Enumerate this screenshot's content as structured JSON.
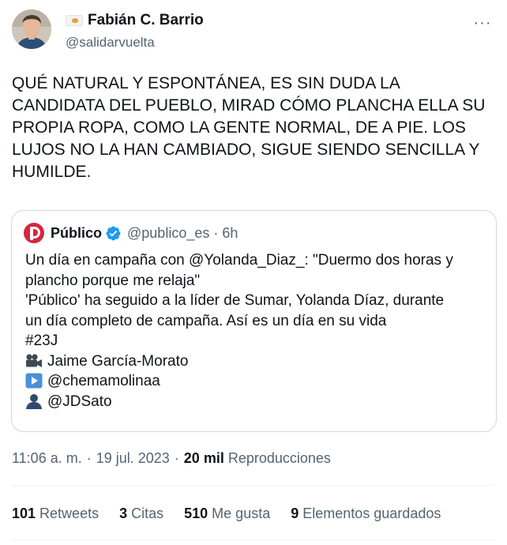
{
  "author": {
    "display_name": "Fabián C. Barrio",
    "handle": "@salidarvuelta",
    "more_label": "···"
  },
  "tweet_text": "QUÉ NATURAL Y ESPONTÁNEA, ES SIN DUDA LA CANDIDATA DEL PUEBLO, MIRAD CÓMO PLANCHA ELLA SU PROPIA ROPA, COMO LA GENTE NORMAL, DE A PIE. LOS LUJOS NO LA HAN CAMBIADO, SIGUE SIENDO SENCILLA Y HUMILDE.",
  "quoted": {
    "name": "Público",
    "handle": "@publico_es",
    "separator": "·",
    "time": "6h",
    "lines": [
      "Un día en campaña con @Yolanda_Diaz_: \"Duermo dos horas y",
      "plancho porque me relaja\"",
      "'Público' ha seguido a la líder de Sumar, Yolanda Díaz, durante",
      "un día completo de campaña. Así es un día en su vida",
      "#23J"
    ],
    "credits": [
      {
        "icon": "movie-camera-icon",
        "text": "Jaime García-Morato"
      },
      {
        "icon": "play-button-icon",
        "text": "@chemamolinaa"
      },
      {
        "icon": "bust-silhouette-icon",
        "text": "@JDSato"
      }
    ]
  },
  "meta": {
    "time": "11:06 a. m.",
    "separator1": "·",
    "date": "19 jul. 2023",
    "separator2": "·",
    "views_count": "20 mil",
    "views_label": "Reproducciones"
  },
  "stats": {
    "retweets": {
      "num": "101",
      "label": "Retweets"
    },
    "quotes": {
      "num": "3",
      "label": "Citas"
    },
    "likes": {
      "num": "510",
      "label": "Me gusta"
    },
    "bookmarks": {
      "num": "9",
      "label": "Elementos guardados"
    }
  },
  "colors": {
    "text": "#0f1419",
    "secondary": "#536471",
    "border": "#cfd9de",
    "verified": "#1d9bf0",
    "publico_red": "#d7263d"
  }
}
